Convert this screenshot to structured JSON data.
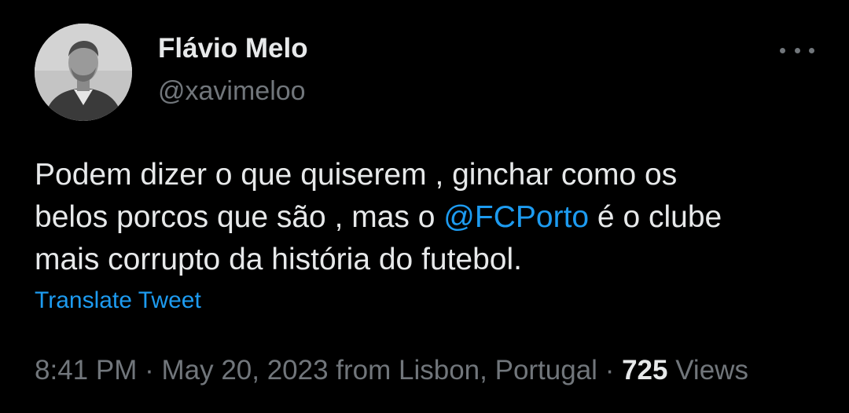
{
  "author": {
    "display_name": "Flávio Melo",
    "handle": "@xavimeloo"
  },
  "menu_icon": "more-horizontal-icon",
  "tweet": {
    "line1": "Podem dizer o que quiserem , ginchar como os",
    "line2_before": "belos porcos que são , mas o ",
    "mention": "@FCPorto",
    "line2_after": " é o clube",
    "line3": "mais corrupto da história do futebol."
  },
  "translate_label": "Translate Tweet",
  "meta": {
    "time": "8:41 PM",
    "sep1": " · ",
    "date": "May 20, 2023",
    "location": " from Lisbon, Portugal",
    "sep2": " · ",
    "views_count": "725",
    "views_label": " Views"
  },
  "colors": {
    "background": "#000000",
    "text": "#e7e9ea",
    "muted": "#71767b",
    "accent": "#1d9bf0"
  }
}
